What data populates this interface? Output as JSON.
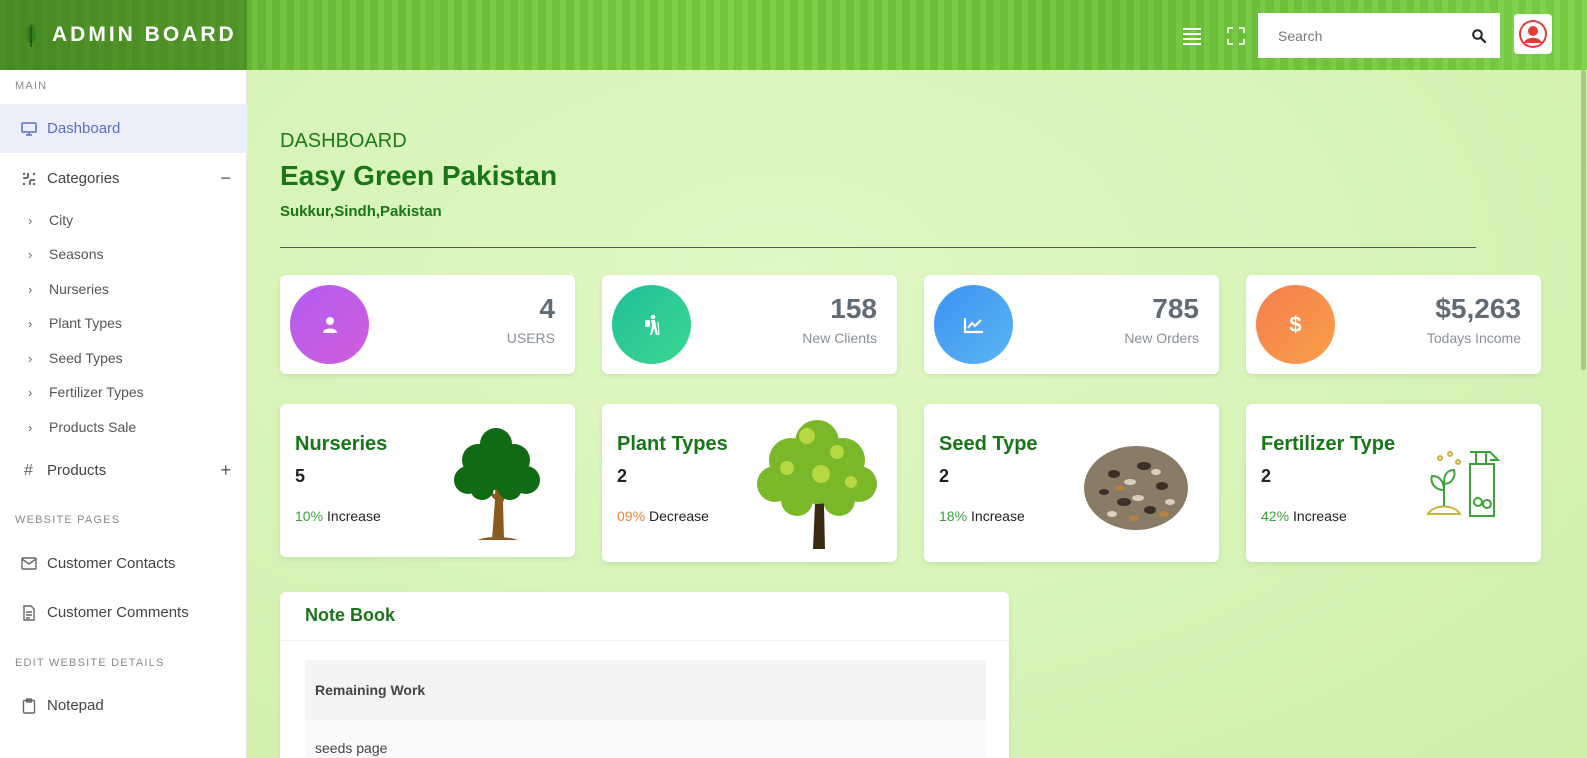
{
  "header": {
    "brand": "ADMIN BOARD",
    "search_placeholder": "Search"
  },
  "sidebar": {
    "section_main": "MAIN",
    "dashboard": "Dashboard",
    "categories": "Categories",
    "categories_toggle": "−",
    "sub_items": [
      "City",
      "Seasons",
      "Nurseries",
      "Plant Types",
      "Seed Types",
      "Fertilizer Types",
      "Products Sale"
    ],
    "products": "Products",
    "products_toggle": "+",
    "section_website": "WEBSITE PAGES",
    "customer_contacts": "Customer Contacts",
    "customer_comments": "Customer Comments",
    "section_edit": "EDIT WEBSITE DETAILS",
    "notepad": "Notepad"
  },
  "page": {
    "kicker": "DASHBOARD",
    "title": "Easy Green Pakistan",
    "subtitle": "Sukkur,Sindh,Pakistan"
  },
  "stats": [
    {
      "value": "4",
      "label": "USERS",
      "icon": "user-icon"
    },
    {
      "value": "158",
      "label": "New Clients",
      "icon": "hiker-icon"
    },
    {
      "value": "785",
      "label": "New Orders",
      "icon": "chart-line-icon"
    },
    {
      "value": "$5,263",
      "label": "Todays Income",
      "icon": "dollar-icon"
    }
  ],
  "info_cards": [
    {
      "title": "Nurseries",
      "count": "5",
      "pct": "10%",
      "trend": "Increase",
      "pct_color": "#3aa33a"
    },
    {
      "title": "Plant Types",
      "count": "2",
      "pct": "09%",
      "trend": "Decrease",
      "pct_color": "#e8873a"
    },
    {
      "title": "Seed Type",
      "count": "2",
      "pct": "18%",
      "trend": "Increase",
      "pct_color": "#3aa33a"
    },
    {
      "title": "Fertilizer Type",
      "count": "2",
      "pct": "42%",
      "trend": "Increase",
      "pct_color": "#3aa33a"
    }
  ],
  "notebook": {
    "title": "Note Book",
    "header_row": "Remaining Work",
    "row_1": "seeds page"
  }
}
